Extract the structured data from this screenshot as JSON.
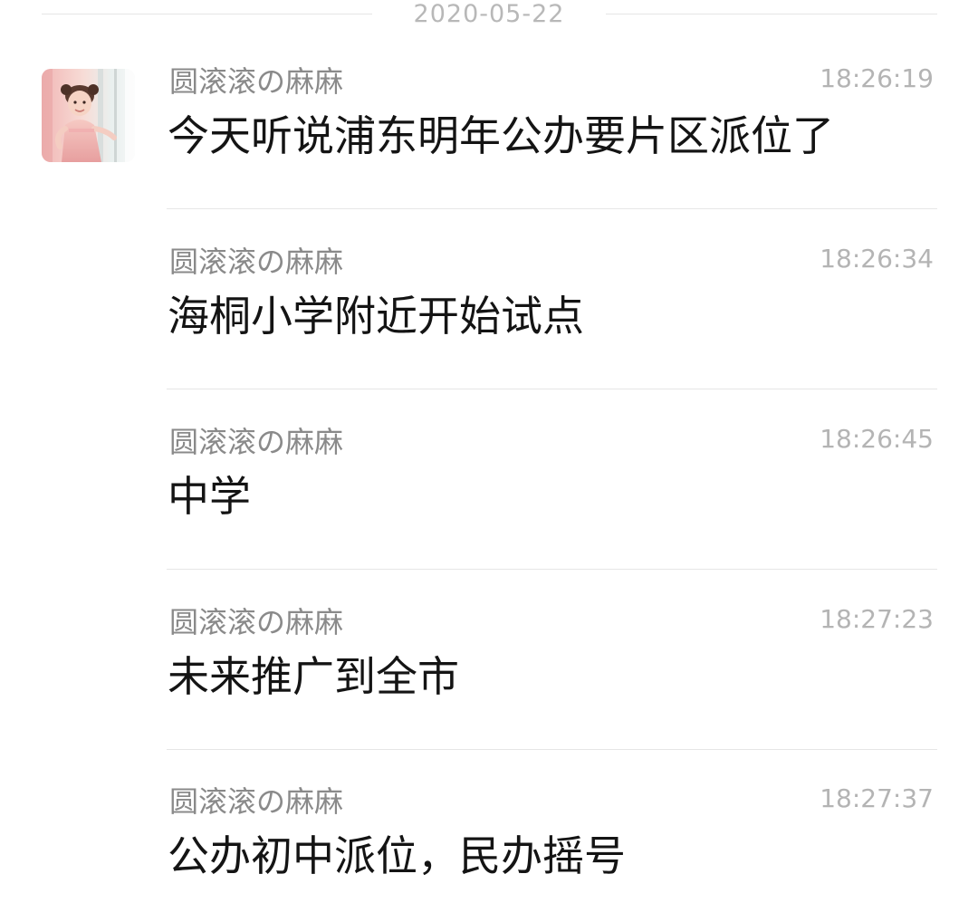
{
  "date_separator": "2020-05-22",
  "messages": [
    {
      "sender": "圆滚滚の麻麻",
      "time": "18:26:19",
      "text": "今天听说浦东明年公办要片区派位了",
      "show_avatar": true
    },
    {
      "sender": "圆滚滚の麻麻",
      "time": "18:26:34",
      "text": "海桐小学附近开始试点",
      "show_avatar": false
    },
    {
      "sender": "圆滚滚の麻麻",
      "time": "18:26:45",
      "text": "中学",
      "show_avatar": false
    },
    {
      "sender": "圆滚滚の麻麻",
      "time": "18:27:23",
      "text": "未来推广到全市",
      "show_avatar": false
    },
    {
      "sender": "圆滚滚の麻麻",
      "time": "18:27:37",
      "text": "公办初中派位，民办摇号",
      "show_avatar": false
    }
  ],
  "colors": {
    "background": "#ffffff",
    "sender": "#8a8a8a",
    "time": "#b4b4b4",
    "message_text": "#141414",
    "divider": "#e6e6e6",
    "date_text": "#b8b8b8"
  },
  "icons": {
    "avatar": "user-photo-avatar"
  }
}
